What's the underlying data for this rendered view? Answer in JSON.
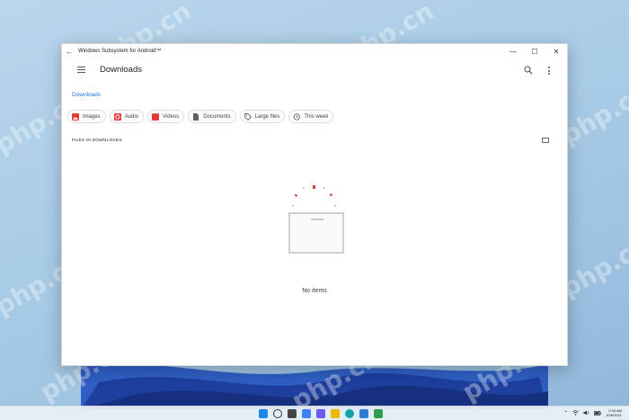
{
  "window": {
    "title": "Windows Subsystem for Android™",
    "back_glyph": "←",
    "minimize_glyph": "—",
    "maximize_glyph": "☐",
    "close_glyph": "✕"
  },
  "appbar": {
    "title": "Downloads"
  },
  "breadcrumb": {
    "label": "Downloads"
  },
  "chips": [
    {
      "label": "Images",
      "icon": "image-icon",
      "color": "#e53935"
    },
    {
      "label": "Audio",
      "icon": "audio-icon",
      "color": "#e53935"
    },
    {
      "label": "Videos",
      "icon": "video-icon",
      "color": "#e53935"
    },
    {
      "label": "Documents",
      "icon": "document-icon",
      "color": "#5f6368"
    },
    {
      "label": "Large files",
      "icon": "tag-icon",
      "color": "#5f6368"
    },
    {
      "label": "This week",
      "icon": "history-icon",
      "color": "#5f6368"
    }
  ],
  "section": {
    "label": "FILES IN DOWNLOADS"
  },
  "empty_state": {
    "message": "No items"
  },
  "watermark": {
    "text": "php.cn"
  },
  "taskbar": {
    "tray_glyph": "⌃",
    "time": "9:28 AM",
    "date": "10/6/2021"
  },
  "colors": {
    "accent": "#1a73e8",
    "chip_red": "#e53935"
  }
}
